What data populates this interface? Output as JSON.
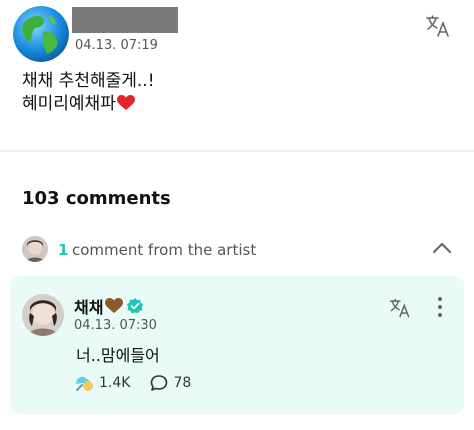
{
  "post": {
    "timestamp": "04.13. 07:19",
    "text_line1": "채채 추천해줄게..!",
    "text_line2": "혜미리예채파",
    "avatar_icon": "globe-icon",
    "translate_icon": "translate-icon",
    "emoji": "red-heart-icon"
  },
  "comments": {
    "count_label": "103 comments"
  },
  "artist_section": {
    "count": "1",
    "label": "comment from the artist",
    "toggle_icon": "chevron-up-icon"
  },
  "artist_comment": {
    "name": "채채",
    "name_emoji": "brown-heart-icon",
    "badge": "verified-badge-icon",
    "timestamp": "04.13. 07:30",
    "text": "너..맘에들어",
    "likes": "1.4K",
    "replies": "78"
  },
  "colors": {
    "accent": "#20c7b6",
    "card_bg": "#e8fbf7",
    "verified": "#1fc4b4"
  }
}
